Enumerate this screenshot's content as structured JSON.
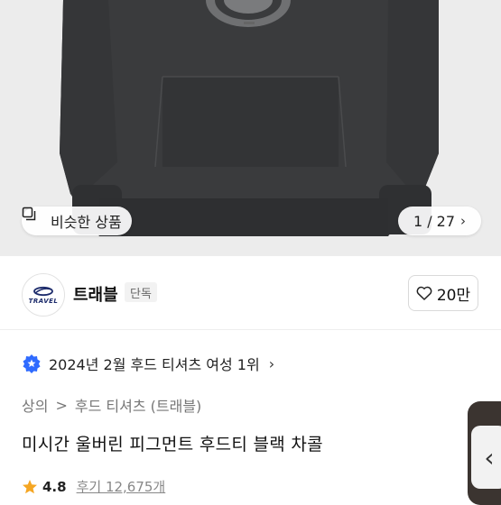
{
  "hero": {
    "similar_label": "비슷한 상품",
    "page_indicator": "1 / 27",
    "icons": [
      "similar-items-icon",
      "chevron-right-icon"
    ]
  },
  "brand": {
    "logo_text": "TRAVEL",
    "name": "트래블",
    "tag": "단독",
    "like_count": "20만",
    "icons": [
      "heart-outline-icon"
    ]
  },
  "ranking": {
    "text": "2024년 2월 후드 티셔츠 여성 1위",
    "icons": [
      "ranking-badge-icon",
      "chevron-right-icon"
    ]
  },
  "breadcrumb": {
    "items": [
      "상의",
      "후드 티셔츠 (트래블)"
    ],
    "separator": ">"
  },
  "product": {
    "title": "미시간 울버린 피그먼트 후드티 블랙 차콜"
  },
  "rating": {
    "score": "4.8",
    "reviews": "후기 12,675개",
    "icons": [
      "star-icon"
    ]
  },
  "colors": {
    "accent_star": "#f5a623",
    "rank_badge": "#2f6bff",
    "hoodie": "#3a3b3d"
  }
}
